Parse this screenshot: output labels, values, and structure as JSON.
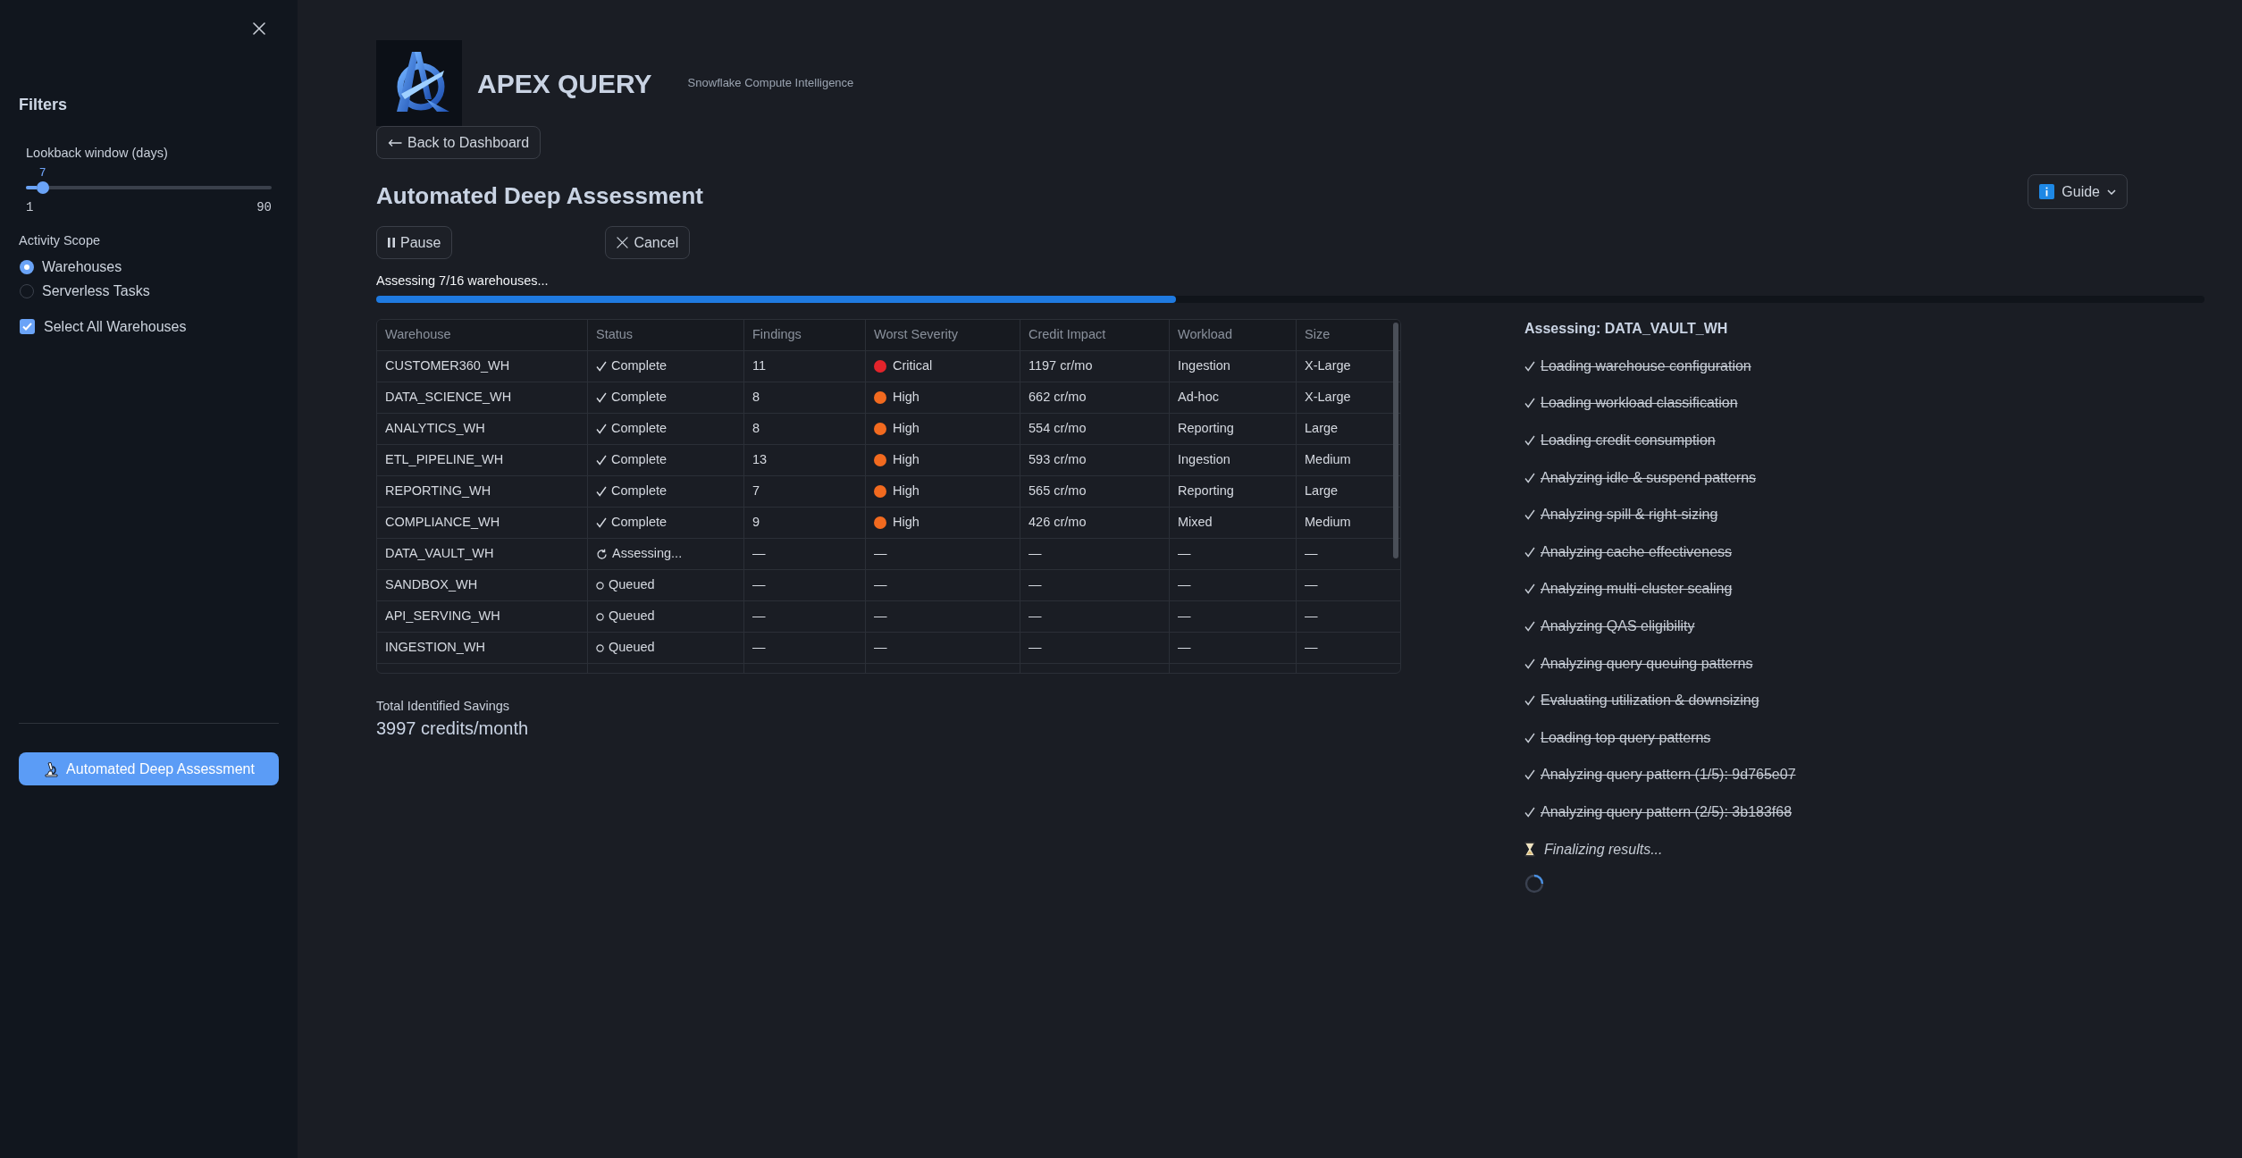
{
  "sidebar": {
    "title": "Filters",
    "lookback": {
      "label": "Lookback window (days)",
      "value": "7",
      "min": "1",
      "max": "90",
      "level": 0.0674
    },
    "activity_scope": {
      "label": "Activity Scope",
      "options": [
        {
          "label": "Warehouses",
          "selected": true
        },
        {
          "label": "Serverless Tasks",
          "selected": false
        }
      ]
    },
    "select_all": {
      "label": "Select All Warehouses",
      "checked": true
    },
    "run_button": "Automated Deep Assessment"
  },
  "header": {
    "brand": "APEX QUERY",
    "tagline": "Snowflake Compute Intelligence",
    "back_button": "Back to Dashboard"
  },
  "assessment": {
    "title": "Automated Deep Assessment",
    "guide_button": "Guide",
    "pause_button": "Pause",
    "cancel_button": "Cancel",
    "progress": {
      "label": "Assessing 7/16 warehouses...",
      "level": 0.4375
    },
    "table": {
      "columns": [
        "Warehouse",
        "Status",
        "Findings",
        "Worst Severity",
        "Credit Impact",
        "Workload",
        "Size"
      ],
      "rows": [
        {
          "warehouse": "CUSTOMER360_WH",
          "status": {
            "kind": "complete",
            "label": "Complete"
          },
          "findings": "11",
          "severity": {
            "label": "Critical",
            "color": "#e3242b"
          },
          "credit_impact": "1197 cr/mo",
          "workload": "Ingestion",
          "size": "X-Large"
        },
        {
          "warehouse": "DATA_SCIENCE_WH",
          "status": {
            "kind": "complete",
            "label": "Complete"
          },
          "findings": "8",
          "severity": {
            "label": "High",
            "color": "#f26a1f"
          },
          "credit_impact": "662 cr/mo",
          "workload": "Ad-hoc",
          "size": "X-Large"
        },
        {
          "warehouse": "ANALYTICS_WH",
          "status": {
            "kind": "complete",
            "label": "Complete"
          },
          "findings": "8",
          "severity": {
            "label": "High",
            "color": "#f26a1f"
          },
          "credit_impact": "554 cr/mo",
          "workload": "Reporting",
          "size": "Large"
        },
        {
          "warehouse": "ETL_PIPELINE_WH",
          "status": {
            "kind": "complete",
            "label": "Complete"
          },
          "findings": "13",
          "severity": {
            "label": "High",
            "color": "#f26a1f"
          },
          "credit_impact": "593 cr/mo",
          "workload": "Ingestion",
          "size": "Medium"
        },
        {
          "warehouse": "REPORTING_WH",
          "status": {
            "kind": "complete",
            "label": "Complete"
          },
          "findings": "7",
          "severity": {
            "label": "High",
            "color": "#f26a1f"
          },
          "credit_impact": "565 cr/mo",
          "workload": "Reporting",
          "size": "Large"
        },
        {
          "warehouse": "COMPLIANCE_WH",
          "status": {
            "kind": "complete",
            "label": "Complete"
          },
          "findings": "9",
          "severity": {
            "label": "High",
            "color": "#f26a1f"
          },
          "credit_impact": "426 cr/mo",
          "workload": "Mixed",
          "size": "Medium"
        },
        {
          "warehouse": "DATA_VAULT_WH",
          "status": {
            "kind": "assessing",
            "label": "Assessing..."
          },
          "findings": "—",
          "severity": {
            "label": "—"
          },
          "credit_impact": "—",
          "workload": "—",
          "size": "—"
        },
        {
          "warehouse": "SANDBOX_WH",
          "status": {
            "kind": "queued",
            "label": "Queued"
          },
          "findings": "—",
          "severity": {
            "label": "—"
          },
          "credit_impact": "—",
          "workload": "—",
          "size": "—"
        },
        {
          "warehouse": "API_SERVING_WH",
          "status": {
            "kind": "queued",
            "label": "Queued"
          },
          "findings": "—",
          "severity": {
            "label": "—"
          },
          "credit_impact": "—",
          "workload": "—",
          "size": "—"
        },
        {
          "warehouse": "INGESTION_WH",
          "status": {
            "kind": "queued",
            "label": "Queued"
          },
          "findings": "—",
          "severity": {
            "label": "—"
          },
          "credit_impact": "—",
          "workload": "—",
          "size": "—"
        }
      ]
    },
    "savings": {
      "label": "Total Identified Savings",
      "value": "3997 credits/month"
    },
    "current": {
      "title": "Assessing: DATA_VAULT_WH",
      "steps": [
        {
          "label": "Loading warehouse configuration",
          "done": true
        },
        {
          "label": "Loading workload classification",
          "done": true
        },
        {
          "label": "Loading credit consumption",
          "done": true
        },
        {
          "label": "Analyzing idle & suspend patterns",
          "done": true
        },
        {
          "label": "Analyzing spill & right-sizing",
          "done": true
        },
        {
          "label": "Analyzing cache effectiveness",
          "done": true
        },
        {
          "label": "Analyzing multi-cluster scaling",
          "done": true
        },
        {
          "label": "Analyzing QAS eligibility",
          "done": true
        },
        {
          "label": "Analyzing query queuing patterns",
          "done": true
        },
        {
          "label": "Evaluating utilization & downsizing",
          "done": true
        },
        {
          "label": "Loading top query patterns",
          "done": true
        },
        {
          "label": "Analyzing query pattern (1/5): 9d765e07",
          "done": true
        },
        {
          "label": "Analyzing query pattern (2/5): 3b183f68",
          "done": true
        },
        {
          "label": "Finalizing results...",
          "done": false
        }
      ]
    }
  }
}
